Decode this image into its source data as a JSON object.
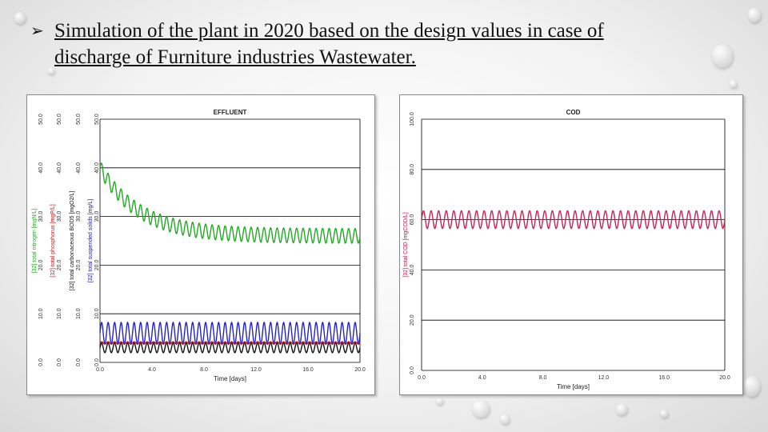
{
  "slide": {
    "bullet_glyph": "➢",
    "title_line1": "Simulation of the plant in 2020 based on the design values in case of",
    "title_line2": "discharge of Furniture industries Wastewater."
  },
  "chart_data": [
    {
      "type": "line",
      "title": "EFFLUENT",
      "xlabel": "Time [days]",
      "xlim": [
        0,
        20
      ],
      "xticks": [
        "0.0",
        "4.0",
        "8.0",
        "12.0",
        "16.0",
        "20.0"
      ],
      "ylim": [
        0,
        50
      ],
      "grid": true,
      "y_axes": [
        {
          "label": "[32] total nitrogen [mgN/L]",
          "color": "#22aa22",
          "ticks": [
            "0.0",
            "10.0",
            "20.0",
            "30.0",
            "40.0",
            "50.0"
          ]
        },
        {
          "label": "[32] total phosphorus [mgP/L]",
          "color": "#cc1111",
          "ticks": [
            "0.0",
            "10.0",
            "20.0",
            "30.0",
            "40.0",
            "50.0"
          ]
        },
        {
          "label": "[32] total carbonaceous BOD5 [mgO2/L]",
          "color": "#111111",
          "ticks": [
            "0.0",
            "10.0",
            "20.0",
            "30.0",
            "40.0",
            "50.0"
          ]
        },
        {
          "label": "[32] total suspended solids [mg/L]",
          "color": "#1a1aaa",
          "ticks": [
            "0.0",
            "10.0",
            "20.0",
            "30.0",
            "40.0",
            "50.0"
          ]
        }
      ],
      "series": [
        {
          "name": "[32] total nitrogen [mgN/L]",
          "color": "#22aa22",
          "start": 40.0,
          "steady": 26.0,
          "decay_days": 3.0,
          "amplitude": 1.5,
          "cycles_per_day": 2
        },
        {
          "name": "[32] total suspended solids [mg/L]",
          "color": "#2222cc",
          "mean": 6.0,
          "amplitude": 2.2,
          "cycles_per_day": 2
        },
        {
          "name": "[32] total carbonaceous BOD5 [mgO2/L]",
          "color": "#111111",
          "mean": 3.0,
          "amplitude": 1.0,
          "cycles_per_day": 2
        },
        {
          "name": "[32] total phosphorus [mgP/L]",
          "color": "#dd1111",
          "mean": 4.0,
          "amplitude": 0.25,
          "cycles_per_day": 2
        }
      ]
    },
    {
      "type": "line",
      "title": "COD",
      "xlabel": "Time [days]",
      "xlim": [
        0,
        20
      ],
      "xticks": [
        "0.0",
        "4.0",
        "8.0",
        "12.0",
        "16.0",
        "20.0"
      ],
      "ylim": [
        0,
        100
      ],
      "grid": true,
      "y_axes": [
        {
          "label": "[32] total COD [mgCOD/L]",
          "color": "#cc1144",
          "ticks": [
            "0.0",
            "20.0",
            "40.0",
            "60.0",
            "80.0",
            "100.0"
          ]
        }
      ],
      "series": [
        {
          "name": "[32] total COD [mgCOD/L]",
          "color": "#cc2255",
          "mean": 60.0,
          "amplitude": 3.5,
          "cycles_per_day": 2
        }
      ]
    }
  ]
}
